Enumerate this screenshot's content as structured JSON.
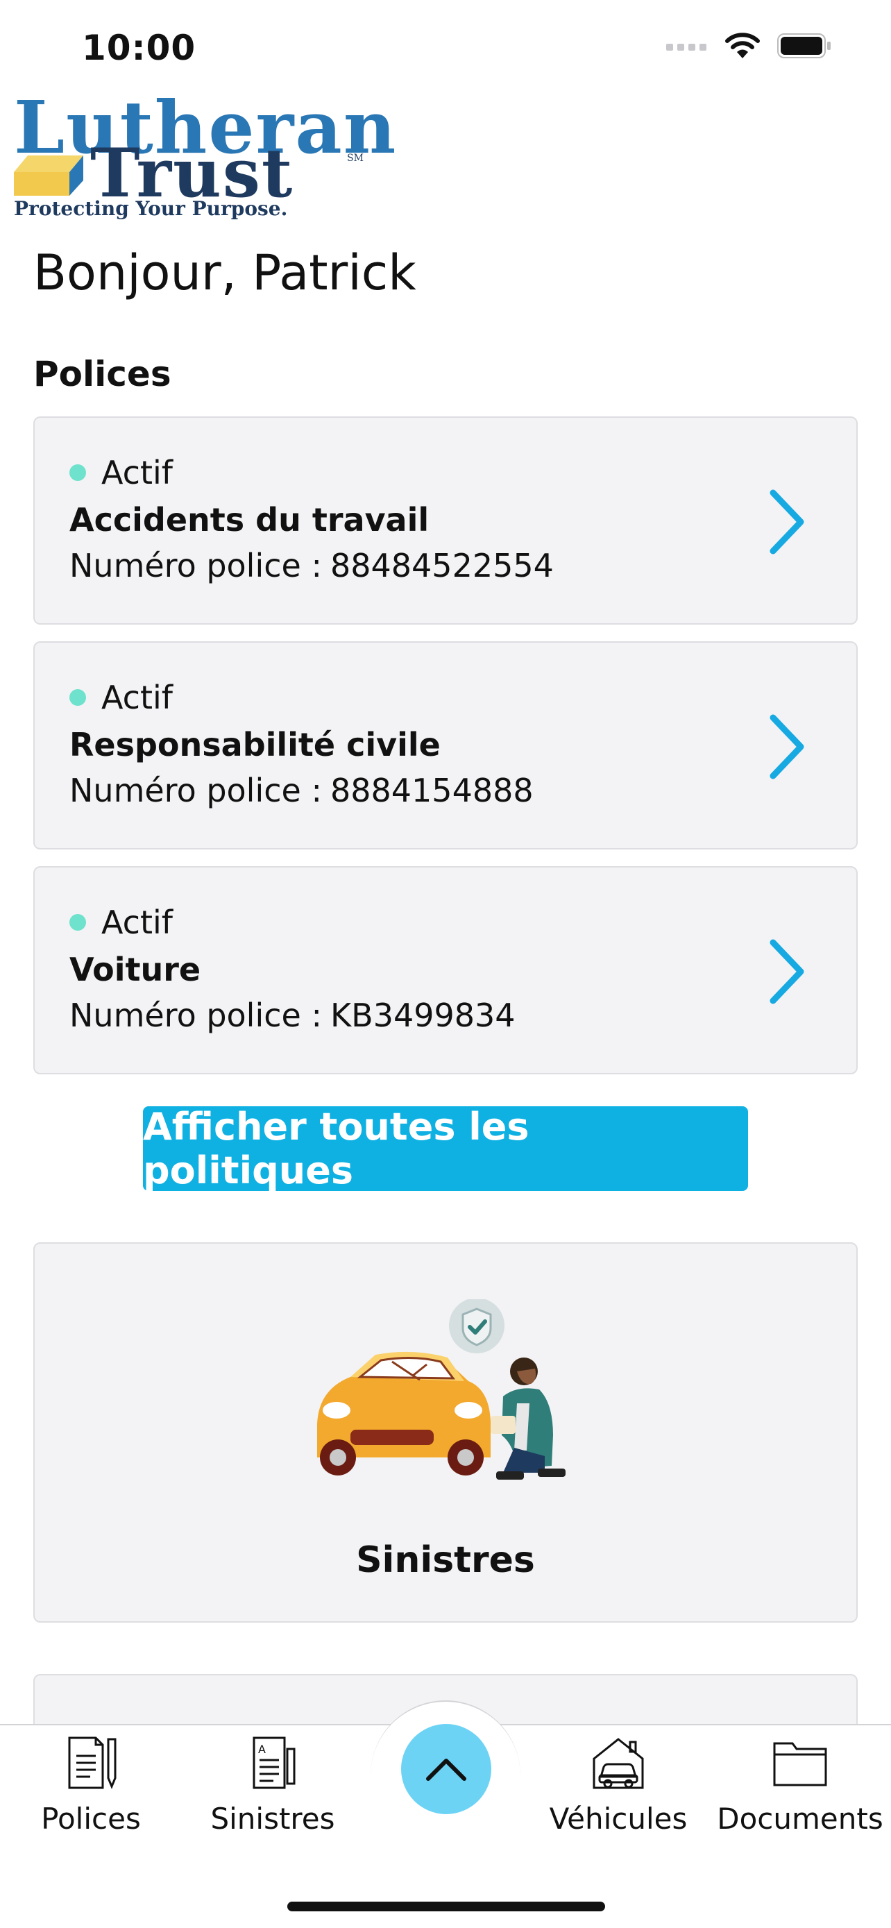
{
  "status_bar": {
    "time": "10:00"
  },
  "logo": {
    "word1": "Lutheran",
    "word2": "Trust",
    "sm": "SM",
    "tagline": "Protecting Your Purpose."
  },
  "greeting": "Bonjour, Patrick",
  "policies": {
    "title": "Polices",
    "number_label": "Numéro police :",
    "items": [
      {
        "status": "Actif",
        "name": "Accidents du travail",
        "number": "88484522554"
      },
      {
        "status": "Actif",
        "name": "Responsabilité civile",
        "number": "8884154888"
      },
      {
        "status": "Actif",
        "name": "Voiture",
        "number": "KB3499834"
      }
    ],
    "show_all_label": "Afficher toutes les politiques"
  },
  "claims_card": {
    "label": "Sinistres"
  },
  "tabbar": {
    "items": [
      {
        "label": "Polices",
        "icon": "policy-document-icon"
      },
      {
        "label": "Sinistres",
        "icon": "claims-document-icon"
      },
      {
        "label": "Véhicules",
        "icon": "vehicle-garage-icon"
      },
      {
        "label": "Documents",
        "icon": "folder-icon"
      }
    ],
    "fab_icon": "chevron-up-icon"
  },
  "colors": {
    "accent": "#0fb0e2",
    "fab": "#6dd3f5",
    "status_dot": "#6ee2cc",
    "card_bg": "#f3f3f5"
  }
}
